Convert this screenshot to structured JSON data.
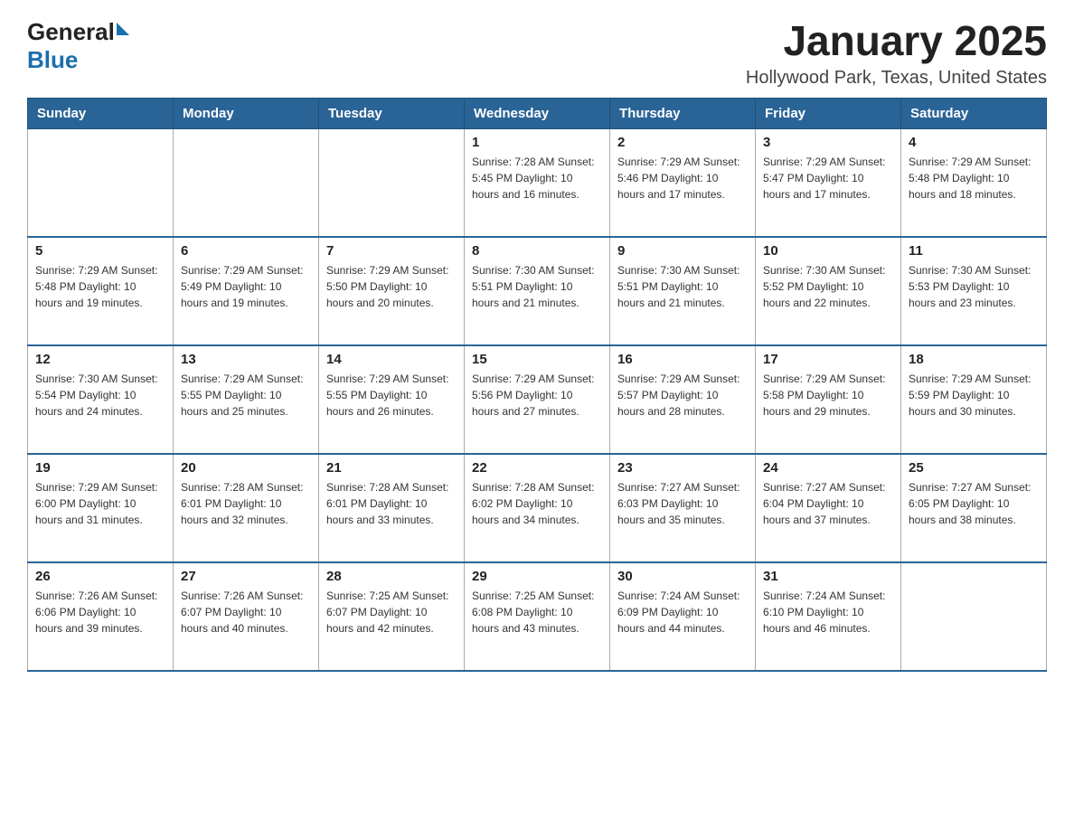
{
  "header": {
    "logo_general": "General",
    "logo_blue": "Blue",
    "title": "January 2025",
    "subtitle": "Hollywood Park, Texas, United States"
  },
  "days_of_week": [
    "Sunday",
    "Monday",
    "Tuesday",
    "Wednesday",
    "Thursday",
    "Friday",
    "Saturday"
  ],
  "weeks": [
    [
      {
        "day": "",
        "info": ""
      },
      {
        "day": "",
        "info": ""
      },
      {
        "day": "",
        "info": ""
      },
      {
        "day": "1",
        "info": "Sunrise: 7:28 AM\nSunset: 5:45 PM\nDaylight: 10 hours\nand 16 minutes."
      },
      {
        "day": "2",
        "info": "Sunrise: 7:29 AM\nSunset: 5:46 PM\nDaylight: 10 hours\nand 17 minutes."
      },
      {
        "day": "3",
        "info": "Sunrise: 7:29 AM\nSunset: 5:47 PM\nDaylight: 10 hours\nand 17 minutes."
      },
      {
        "day": "4",
        "info": "Sunrise: 7:29 AM\nSunset: 5:48 PM\nDaylight: 10 hours\nand 18 minutes."
      }
    ],
    [
      {
        "day": "5",
        "info": "Sunrise: 7:29 AM\nSunset: 5:48 PM\nDaylight: 10 hours\nand 19 minutes."
      },
      {
        "day": "6",
        "info": "Sunrise: 7:29 AM\nSunset: 5:49 PM\nDaylight: 10 hours\nand 19 minutes."
      },
      {
        "day": "7",
        "info": "Sunrise: 7:29 AM\nSunset: 5:50 PM\nDaylight: 10 hours\nand 20 minutes."
      },
      {
        "day": "8",
        "info": "Sunrise: 7:30 AM\nSunset: 5:51 PM\nDaylight: 10 hours\nand 21 minutes."
      },
      {
        "day": "9",
        "info": "Sunrise: 7:30 AM\nSunset: 5:51 PM\nDaylight: 10 hours\nand 21 minutes."
      },
      {
        "day": "10",
        "info": "Sunrise: 7:30 AM\nSunset: 5:52 PM\nDaylight: 10 hours\nand 22 minutes."
      },
      {
        "day": "11",
        "info": "Sunrise: 7:30 AM\nSunset: 5:53 PM\nDaylight: 10 hours\nand 23 minutes."
      }
    ],
    [
      {
        "day": "12",
        "info": "Sunrise: 7:30 AM\nSunset: 5:54 PM\nDaylight: 10 hours\nand 24 minutes."
      },
      {
        "day": "13",
        "info": "Sunrise: 7:29 AM\nSunset: 5:55 PM\nDaylight: 10 hours\nand 25 minutes."
      },
      {
        "day": "14",
        "info": "Sunrise: 7:29 AM\nSunset: 5:55 PM\nDaylight: 10 hours\nand 26 minutes."
      },
      {
        "day": "15",
        "info": "Sunrise: 7:29 AM\nSunset: 5:56 PM\nDaylight: 10 hours\nand 27 minutes."
      },
      {
        "day": "16",
        "info": "Sunrise: 7:29 AM\nSunset: 5:57 PM\nDaylight: 10 hours\nand 28 minutes."
      },
      {
        "day": "17",
        "info": "Sunrise: 7:29 AM\nSunset: 5:58 PM\nDaylight: 10 hours\nand 29 minutes."
      },
      {
        "day": "18",
        "info": "Sunrise: 7:29 AM\nSunset: 5:59 PM\nDaylight: 10 hours\nand 30 minutes."
      }
    ],
    [
      {
        "day": "19",
        "info": "Sunrise: 7:29 AM\nSunset: 6:00 PM\nDaylight: 10 hours\nand 31 minutes."
      },
      {
        "day": "20",
        "info": "Sunrise: 7:28 AM\nSunset: 6:01 PM\nDaylight: 10 hours\nand 32 minutes."
      },
      {
        "day": "21",
        "info": "Sunrise: 7:28 AM\nSunset: 6:01 PM\nDaylight: 10 hours\nand 33 minutes."
      },
      {
        "day": "22",
        "info": "Sunrise: 7:28 AM\nSunset: 6:02 PM\nDaylight: 10 hours\nand 34 minutes."
      },
      {
        "day": "23",
        "info": "Sunrise: 7:27 AM\nSunset: 6:03 PM\nDaylight: 10 hours\nand 35 minutes."
      },
      {
        "day": "24",
        "info": "Sunrise: 7:27 AM\nSunset: 6:04 PM\nDaylight: 10 hours\nand 37 minutes."
      },
      {
        "day": "25",
        "info": "Sunrise: 7:27 AM\nSunset: 6:05 PM\nDaylight: 10 hours\nand 38 minutes."
      }
    ],
    [
      {
        "day": "26",
        "info": "Sunrise: 7:26 AM\nSunset: 6:06 PM\nDaylight: 10 hours\nand 39 minutes."
      },
      {
        "day": "27",
        "info": "Sunrise: 7:26 AM\nSunset: 6:07 PM\nDaylight: 10 hours\nand 40 minutes."
      },
      {
        "day": "28",
        "info": "Sunrise: 7:25 AM\nSunset: 6:07 PM\nDaylight: 10 hours\nand 42 minutes."
      },
      {
        "day": "29",
        "info": "Sunrise: 7:25 AM\nSunset: 6:08 PM\nDaylight: 10 hours\nand 43 minutes."
      },
      {
        "day": "30",
        "info": "Sunrise: 7:24 AM\nSunset: 6:09 PM\nDaylight: 10 hours\nand 44 minutes."
      },
      {
        "day": "31",
        "info": "Sunrise: 7:24 AM\nSunset: 6:10 PM\nDaylight: 10 hours\nand 46 minutes."
      },
      {
        "day": "",
        "info": ""
      }
    ]
  ]
}
